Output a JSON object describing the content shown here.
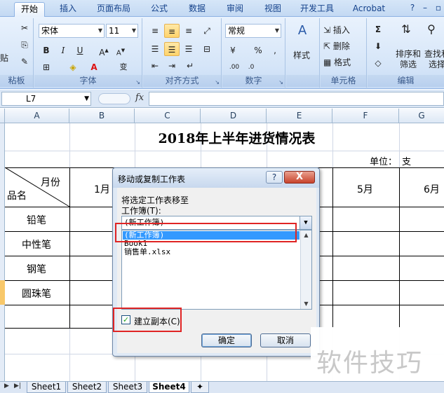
{
  "ribbon": {
    "tabs": [
      "开始",
      "插入",
      "页面布局",
      "公式",
      "数据",
      "审阅",
      "视图",
      "开发工具",
      "Acrobat"
    ],
    "active_tab": "开始",
    "groups": {
      "clipboard": {
        "label": "粘板",
        "paste": "贴"
      },
      "font": {
        "label": "字体",
        "font_name": "宋体",
        "font_size": "11",
        "bold": "B",
        "italic": "I",
        "underline": "U",
        "wen": "变"
      },
      "alignment": {
        "label": "对齐方式"
      },
      "number": {
        "label": "数字",
        "format": "常规",
        "percent": "%"
      },
      "styles": {
        "label": "样式"
      },
      "cells": {
        "label": "单元格",
        "insert": "插入",
        "delete": "删除",
        "format": "格式"
      },
      "editing": {
        "label": "编辑",
        "sort_filter": "排序和\n筛选",
        "find_select": "查找和\n选择",
        "sort_l1": "排序和",
        "sort_l2": "筛选",
        "find_l1": "查找和",
        "find_l2": "选择"
      }
    }
  },
  "formula_bar": {
    "name_box": "L7",
    "fx": "fx",
    "formula": ""
  },
  "columns": [
    "A",
    "B",
    "C",
    "D",
    "E",
    "F",
    "G"
  ],
  "sheet": {
    "title": "2018年上半年进货情况表",
    "unit_label": "单位：",
    "unit_value": "支",
    "header_month": "月份",
    "header_name": "品名",
    "months": [
      "1月",
      "5月",
      "6月"
    ],
    "products": [
      "铅笔",
      "中性笔",
      "钢笔",
      "圆珠笔"
    ]
  },
  "sheet_tabs": [
    "Sheet1",
    "Sheet2",
    "Sheet3",
    "Sheet4"
  ],
  "active_sheet": "Sheet4",
  "dialog": {
    "title": "移动或复制工作表",
    "help": "?",
    "close": "X",
    "move_label": "将选定工作表移至",
    "workbook_label": "工作簿(T):",
    "workbook_value": "(新工作簿)",
    "workbook_list": [
      "(新工作簿)",
      "Book1",
      "销售单.xlsx"
    ],
    "selected_index": 0,
    "copy_label": "建立副本(C)",
    "copy_checked": true,
    "ok": "确定",
    "cancel": "取消"
  },
  "watermark": "软件技巧",
  "colors": {
    "highlight_red": "#e02424",
    "selection_blue": "#3399ff"
  }
}
